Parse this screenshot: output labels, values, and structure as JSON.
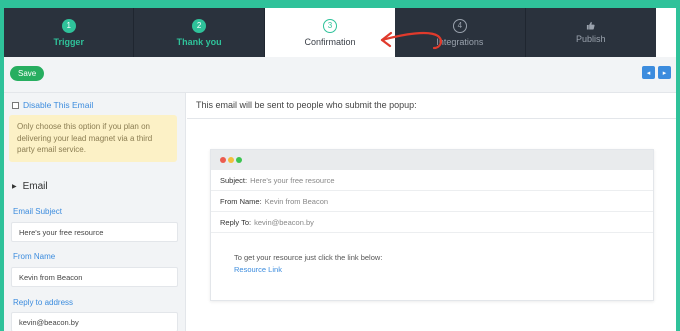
{
  "steps": [
    {
      "num": "1",
      "label": "Trigger"
    },
    {
      "num": "2",
      "label": "Thank you"
    },
    {
      "num": "3",
      "label": "Confirmation"
    },
    {
      "num": "4",
      "label": "Integrations"
    },
    {
      "num": "",
      "label": "Publish"
    }
  ],
  "toolbar": {
    "save_label": "Save",
    "prev_label": "◂",
    "next_label": "▸"
  },
  "sidebar": {
    "disable_label": "Disable This Email",
    "note": "Only choose this option if you plan on delivering your lead magnet via a third party email service.",
    "section_title": "Email",
    "subject_label": "Email Subject",
    "subject_value": "Here's your free resource",
    "from_label": "From Name",
    "from_value": "Kevin from Beacon",
    "reply_label": "Reply to address",
    "reply_value": "kevin@beacon.by"
  },
  "main": {
    "description": "This email will be sent to people who submit the popup:",
    "preview": {
      "subject_key": "Subject:",
      "subject_val": "Here's your free resource",
      "from_key": "From Name:",
      "from_val": "Kevin from Beacon",
      "reply_key": "Reply To:",
      "reply_val": "kevin@beacon.by",
      "body_text": "To get your resource just click the link below:",
      "link_text": "Resource Link"
    }
  },
  "colors": {
    "accent": "#2fc29a",
    "dark": "#2a323d",
    "link": "#3c8cde",
    "save": "#27ae60",
    "note_bg": "#fcf1c6",
    "arrow": "#e03a2c"
  },
  "icons": {
    "publish": "thumbs-up-icon",
    "dots": [
      "red-dot",
      "yellow-dot",
      "green-dot"
    ]
  }
}
